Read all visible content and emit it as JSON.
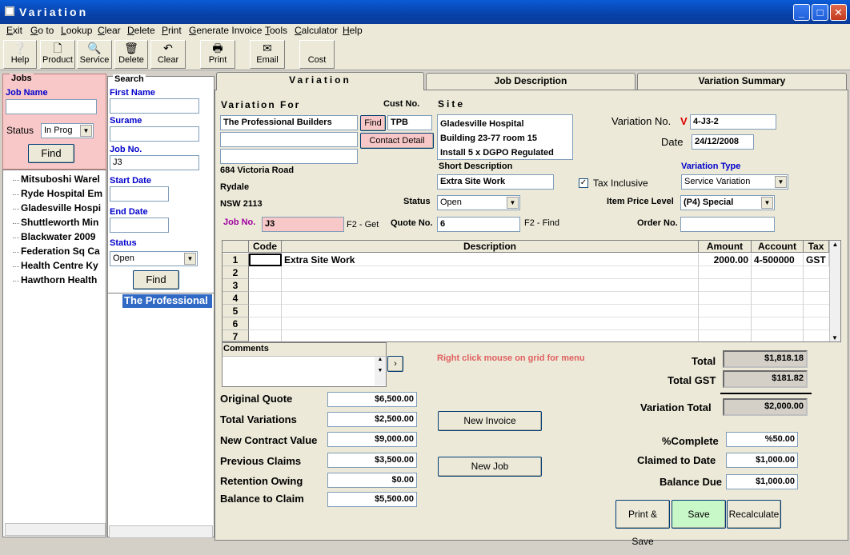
{
  "window": {
    "title": "Variation"
  },
  "menu": [
    "Exit",
    "Go to",
    "Lookup",
    "Clear",
    "Delete",
    "Print",
    "Generate Invoice",
    "Tools",
    "Calculator",
    "Help"
  ],
  "toolbar": [
    {
      "label": "Help",
      "icon": "help-icon"
    },
    {
      "label": "Product",
      "icon": "document-icon"
    },
    {
      "label": "Service",
      "icon": "magnify-document-icon"
    },
    {
      "label": "Delete",
      "icon": "bin-icon"
    },
    {
      "label": "Clear",
      "icon": "undo-icon"
    },
    {
      "label": "Print",
      "icon": "printer-icon"
    },
    {
      "label": "Email",
      "icon": "envelope-icon"
    },
    {
      "label": "Cost",
      "icon": ""
    }
  ],
  "jobs": {
    "title": "Jobs",
    "job_name_label": "Job Name",
    "job_name_value": "",
    "status_label": "Status",
    "status_value": "In Prog",
    "find_label": "Find"
  },
  "search": {
    "title": "Search",
    "first_name_label": "First Name",
    "surname_label": "Surame",
    "job_no_label": "Job No.",
    "job_no_value": "J3",
    "start_date_label": "Start Date",
    "end_date_label": "End Date",
    "status_label": "Status",
    "status_value": "Open",
    "find_label": "Find",
    "result": "The Professional"
  },
  "tree": [
    "Mitsuboshi Warel",
    "Ryde Hospital Em",
    "Gladesville Hospi",
    "Shuttleworth Min",
    "Blackwater 2009",
    "Federation Sq Ca",
    "Health Centre Ky",
    "Hawthorn Health"
  ],
  "tabs": [
    "Variation",
    "Job Description",
    "Variation Summary"
  ],
  "form": {
    "variation_for_label": "Variation For",
    "cust_no_label": "Cust No.",
    "customer_name": "The Professional Builders",
    "find_label": "Find",
    "cust_no": "TPB",
    "contact_detail_label": "Contact Detail",
    "address1": "684 Victoria Road",
    "address2": "Rydale",
    "address3": "NSW  2113",
    "site_label": "Site",
    "site_lines": [
      "Gladesville Hospital",
      "Building 23-77 room 15",
      "Install 5 x DGPO Regulated"
    ],
    "short_desc_label": "Short Description",
    "short_desc": "Extra Site Work",
    "tax_inclusive_label": "Tax Inclusive",
    "tax_inclusive_check": "✓",
    "variation_no_label": "Variation No.",
    "variation_no_marker": "V",
    "variation_no": "4-J3-2",
    "date_label": "Date",
    "date": "24/12/2008",
    "variation_type_label": "Variation Type",
    "variation_type": "Service Variation",
    "status_label": "Status",
    "status": "Open",
    "item_price_label": "Item Price Level",
    "item_price": "(P4) Special",
    "job_no_label": "Job No.",
    "job_no": "J3",
    "f2_get": "F2 - Get",
    "quote_no_label": "Quote No.",
    "quote_no": "6",
    "f2_find": "F2 - Find",
    "order_no_label": "Order No.",
    "order_no": ""
  },
  "grid": {
    "headers": [
      "Code",
      "Description",
      "Amount",
      "Account",
      "Tax"
    ],
    "rows": [
      {
        "no": "1",
        "code": "",
        "description": "Extra Site Work",
        "amount": "2000.00",
        "account": "4-500000",
        "tax": "GST"
      },
      {
        "no": "2",
        "code": "",
        "description": "",
        "amount": "",
        "account": "",
        "tax": ""
      },
      {
        "no": "3",
        "code": "",
        "description": "",
        "amount": "",
        "account": "",
        "tax": ""
      },
      {
        "no": "4",
        "code": "",
        "description": "",
        "amount": "",
        "account": "",
        "tax": ""
      },
      {
        "no": "5",
        "code": "",
        "description": "",
        "amount": "",
        "account": "",
        "tax": ""
      },
      {
        "no": "6",
        "code": "",
        "description": "",
        "amount": "",
        "account": "",
        "tax": ""
      },
      {
        "no": "7",
        "code": "",
        "description": "",
        "amount": "",
        "account": "",
        "tax": ""
      }
    ]
  },
  "comments_label": "Comments",
  "hint": "Right click mouse on grid for menu",
  "left_totals": [
    {
      "label": "Original Quote",
      "value": "$6,500.00"
    },
    {
      "label": "Total Variations",
      "value": "$2,500.00"
    },
    {
      "label": "New Contract Value",
      "value": "$9,000.00"
    },
    {
      "label": "Previous Claims",
      "value": "$3,500.00"
    },
    {
      "label": "Retention Owing",
      "value": "$0.00"
    },
    {
      "label": "Balance to Claim",
      "value": "$5,500.00"
    }
  ],
  "new_invoice_label": "New Invoice",
  "new_job_label": "New Job",
  "totals": {
    "total_label": "Total",
    "total": "$1,818.18",
    "gst_label": "Total GST",
    "gst": "$181.82",
    "variation_total_label": "Variation Total",
    "variation_total": "$2,000.00",
    "pct_label": "%Complete",
    "pct": "%50.00",
    "claimed_label": "Claimed  to Date",
    "claimed": "$1,000.00",
    "balance_label": "Balance Due",
    "balance": "$1,000.00"
  },
  "actions": {
    "print_save": "Print & Save",
    "save": "Save",
    "recalculate": "Recalculate"
  },
  "colors": {
    "accent": "#0a5bd6",
    "jobs_panel": "#f8c8c8",
    "save_button": "#c8f8c8",
    "hint": "#e06060"
  }
}
